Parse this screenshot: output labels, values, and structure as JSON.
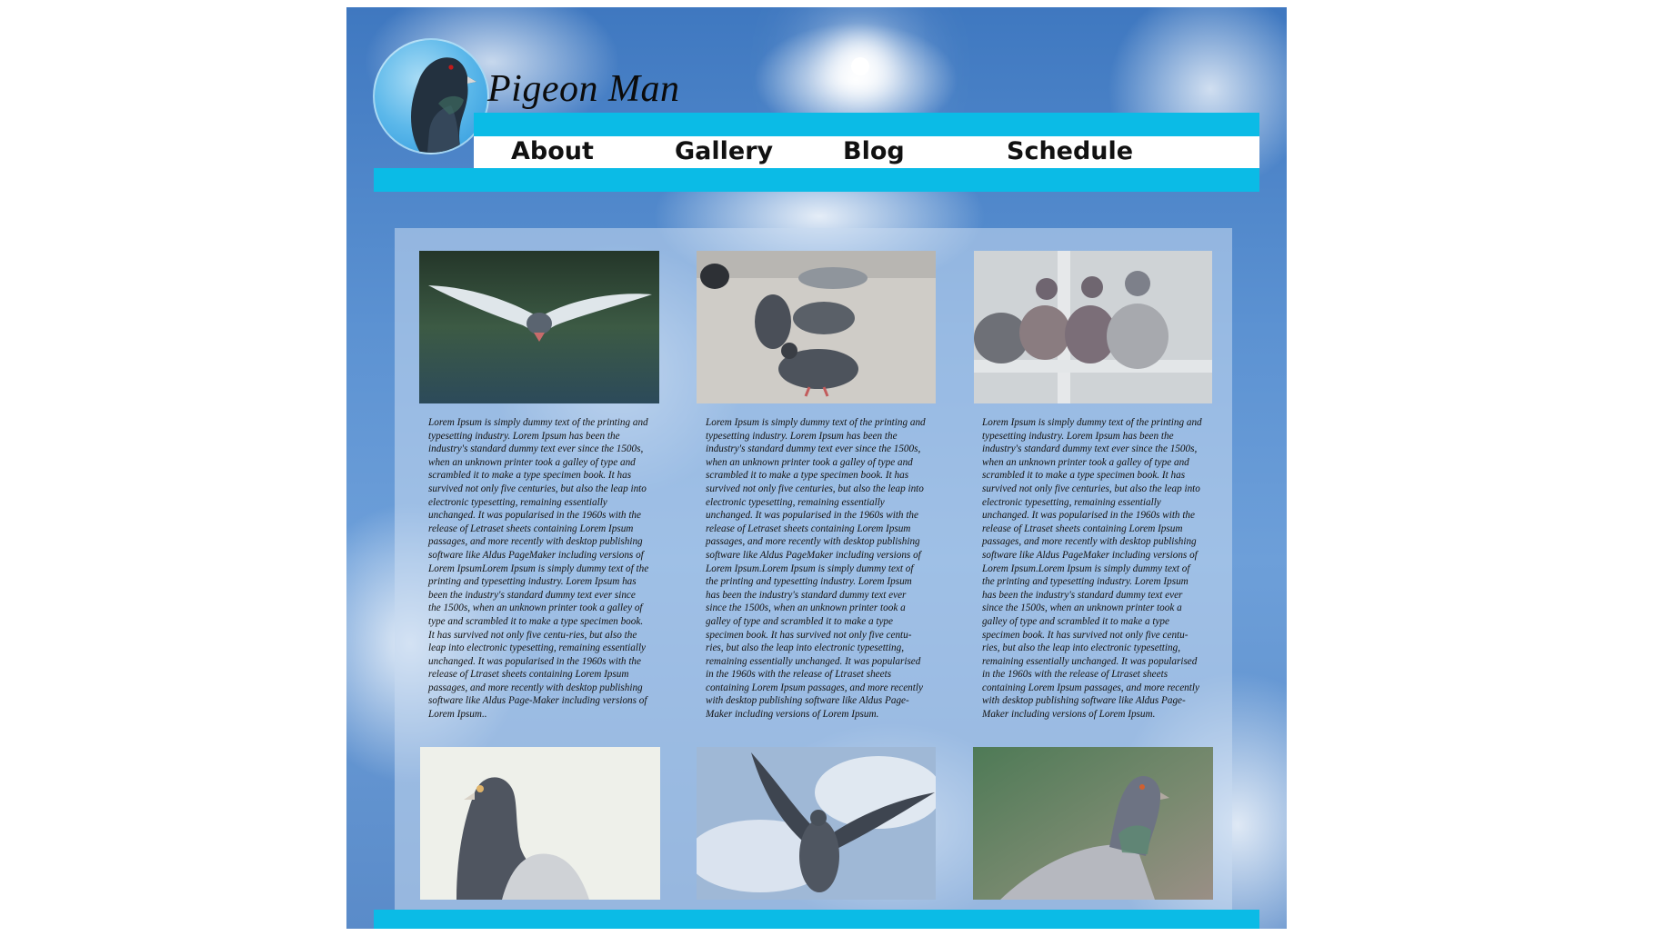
{
  "site": {
    "title": "Pigeon Man"
  },
  "nav": {
    "items": [
      {
        "label": "About"
      },
      {
        "label": "Gallery"
      },
      {
        "label": "Blog"
      },
      {
        "label": "Schedule"
      }
    ]
  },
  "cards": [
    {
      "image": "pigeon-in-flight",
      "text": "Lorem Ipsum is simply dummy text of the printing and typesetting industry. Lorem Ipsum has been the industry's standard dummy text ever since the 1500s, when an unknown printer took a galley of type and scrambled it to make a type specimen book. It has survived not only five centuries, but also the leap into electronic typesetting, remaining essentially unchanged. It was popularised in the 1960s with the release of Letraset sheets containing Lorem Ipsum passages, and more recently with desktop publishing software like Aldus PageMaker including versions of Lorem IpsumLorem Ipsum is simply dummy text of the printing and typesetting industry. Lorem Ipsum has been the industry's standard dummy text ever since the 1500s, when an unknown printer took a galley of type and scrambled it to make a type specimen book. It has survived not only five centu-ries, but also the leap into electronic typesetting, remaining essentially unchanged. It was popularised in the 1960s with the release of Ltraset sheets containing Lorem Ipsum passages, and more recently with desktop publishing software like Aldus Page-Maker including versions of Lorem Ipsum.."
    },
    {
      "image": "pigeons-on-ground",
      "text": "Lorem Ipsum is simply dummy text of the printing and typesetting industry. Lorem Ipsum has been the industry's standard dummy text ever since the 1500s, when an unknown printer took a galley of type and scrambled it to make a type specimen book. It has survived not only five centuries, but also the leap into electronic typesetting, remaining essentially unchanged. It was popularised in the 1960s with the release of Letraset sheets containing Lorem Ipsum passages, and more recently with desktop publishing software like Aldus PageMaker including versions of Lorem Ipsum.Lorem Ipsum is simply dummy text of the printing and typesetting industry. Lorem Ipsum has been the industry's standard dummy text ever since the 1500s, when an unknown printer took a galley of type and scrambled it to make a type specimen book. It has survived not only five centu-ries, but also the leap into electronic typesetting, remaining essentially unchanged. It was popularised in the 1960s with the release of Ltraset sheets containing Lorem Ipsum passages, and more recently with desktop publishing software like Aldus Page-Maker including versions of Lorem Ipsum."
    },
    {
      "image": "pigeons-on-rail",
      "text": "Lorem Ipsum is simply dummy text of the printing and typesetting industry. Lorem Ipsum has been the industry's standard dummy text ever since the 1500s, when an unknown printer took a galley of type and scrambled it to make a type specimen book. It has survived not only five centuries, but also the leap into electronic typesetting, remaining essentially unchanged. It was popularised in the 1960s with the release of Ltraset sheets containing Lorem Ipsum passages, and more recently with desktop publishing software like Aldus PageMaker including versions of Lorem Ipsum.Lorem Ipsum is simply dummy text of the printing and typesetting industry. Lorem Ipsum has been the industry's standard dummy text ever since the 1500s, when an unknown printer took a galley of type and scrambled it to make a type specimen book. It has survived not only five centu-ries, but also the leap into electronic typesetting, remaining essentially unchanged. It was popularised in the 1960s with the release of Ltraset sheets containing Lorem Ipsum passages, and more recently with desktop publishing software like Aldus Page-Maker including versions of Lorem Ipsum."
    },
    {
      "image": "pigeon-portrait"
    },
    {
      "image": "pigeon-wings-spread"
    },
    {
      "image": "pigeon-on-green"
    }
  ],
  "colors": {
    "accent_bar": "#0bbbe6",
    "nav_background": "#ffffff",
    "sky": "#5c92d2"
  }
}
